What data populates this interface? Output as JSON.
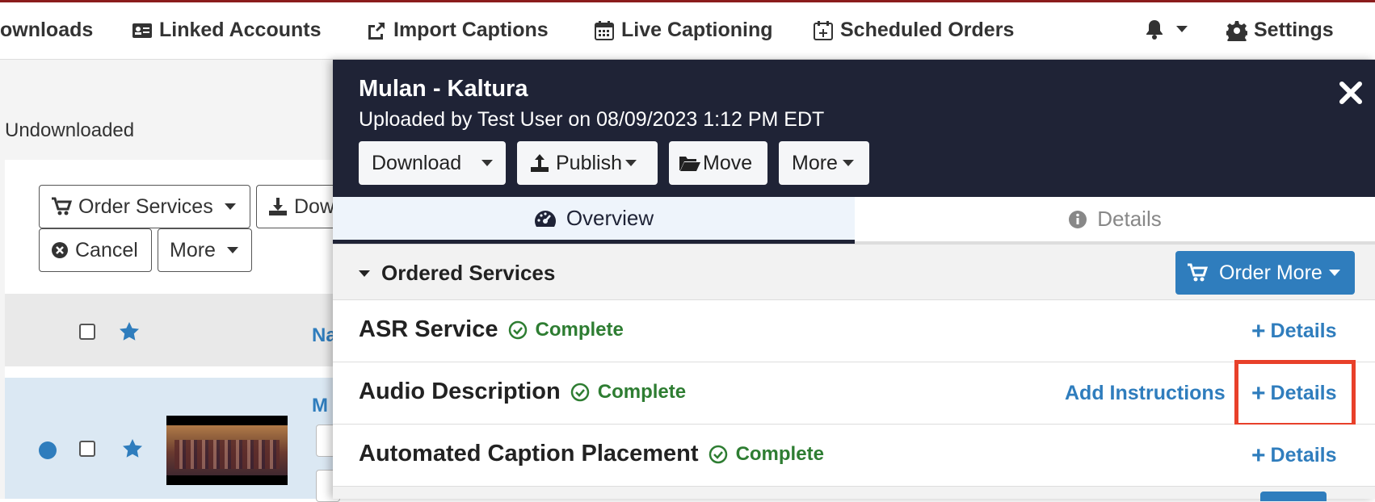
{
  "nav": {
    "downloads": "ownloads",
    "linked_accounts": "Linked Accounts",
    "import_captions": "Import Captions",
    "live_captioning": "Live Captioning",
    "scheduled_orders": "Scheduled Orders",
    "settings": "Settings"
  },
  "left": {
    "filter_label": "Undownloaded",
    "order_services": "Order Services",
    "download_partial": "Dow",
    "cancel": "Cancel",
    "more": "More",
    "name_header_partial": "Na",
    "row_title_partial": "M"
  },
  "modal": {
    "title": "Mulan - Kaltura",
    "subtitle": "Uploaded by Test User on 08/09/2023 1:12 PM EDT",
    "buttons": {
      "download": "Download",
      "publish": "Publish",
      "move": "Move",
      "more": "More"
    },
    "tabs": {
      "overview": "Overview",
      "details": "Details"
    },
    "section": {
      "title": "Ordered Services",
      "order_more": "Order More"
    },
    "services": [
      {
        "name": "ASR Service",
        "status": "Complete",
        "details": "Details"
      },
      {
        "name": "Audio Description",
        "status": "Complete",
        "add_instructions": "Add Instructions",
        "details": "Details"
      },
      {
        "name": "Automated Caption Placement",
        "status": "Complete",
        "details": "Details"
      }
    ]
  },
  "colors": {
    "header_bg": "#1f2336",
    "accent_blue": "#2f7dbd",
    "success_green": "#2e7d32",
    "highlight_red": "#e8402a",
    "top_border": "#8b1c1c"
  }
}
